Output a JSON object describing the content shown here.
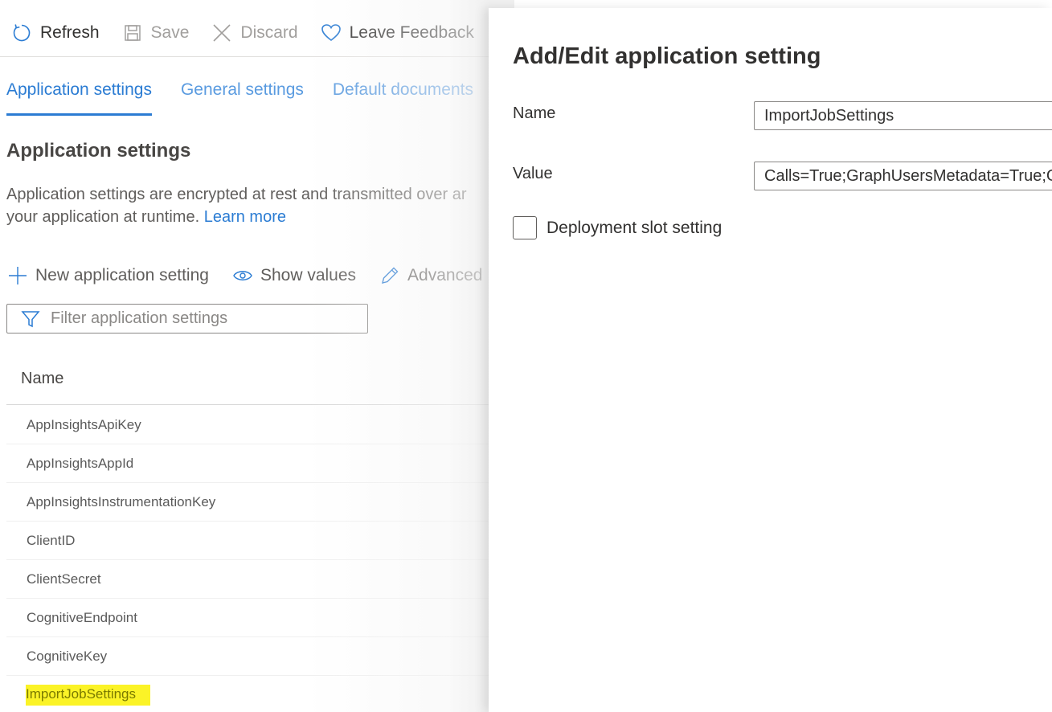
{
  "command_bar": {
    "refresh": "Refresh",
    "save": "Save",
    "discard": "Discard",
    "feedback": "Leave Feedback"
  },
  "tabs": [
    {
      "label": "Application settings",
      "active": true
    },
    {
      "label": "General settings",
      "active": false
    },
    {
      "label": "Default documents",
      "active": false
    }
  ],
  "section": {
    "title": "Application settings",
    "description": "Application settings are encrypted at rest and transmitted over an encrypted channel. You can choose to display them in plain text in your browser by using the controls below. Application Settings are exposed as environment variables for access by your application at runtime.",
    "desc_line1": "Application settings are encrypted at rest and transmitted over ar",
    "desc_line2": "your application at runtime.",
    "learn_more": "Learn more"
  },
  "toolbar": {
    "new_setting": "New application setting",
    "show_values": "Show values",
    "advanced_edit": "Advanced"
  },
  "filter": {
    "placeholder": "Filter application settings"
  },
  "table": {
    "header_name": "Name",
    "rows": [
      "AppInsightsApiKey",
      "AppInsightsAppId",
      "AppInsightsInstrumentationKey",
      "ClientID",
      "ClientSecret",
      "CognitiveEndpoint",
      "CognitiveKey",
      "ImportJobSettings"
    ],
    "highlighted_row_index": 7,
    "highlight_color": "#fbf327"
  },
  "panel": {
    "title": "Add/Edit application setting",
    "name_label": "Name",
    "name_value": "ImportJobSettings",
    "value_label": "Value",
    "value_value": "Calls=True;GraphUsersMetadata=True;G",
    "slot_setting_label": "Deployment slot setting",
    "slot_setting_checked": false
  },
  "colors": {
    "accent": "#2b7cd3",
    "text": "#323130",
    "muted": "#605e5c"
  }
}
